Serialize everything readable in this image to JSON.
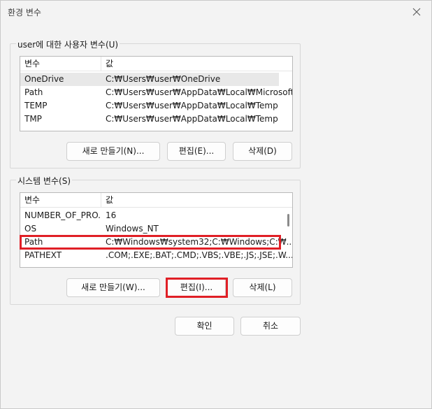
{
  "window": {
    "title": "환경 변수"
  },
  "user_vars": {
    "group_label": "user에 대한 사용자 변수(U)",
    "columns": [
      "변수",
      "값"
    ],
    "rows": [
      {
        "name": "OneDrive",
        "value": "C:₩Users₩user₩OneDrive"
      },
      {
        "name": "Path",
        "value": "C:₩Users₩user₩AppData₩Local₩Microsoft..."
      },
      {
        "name": "TEMP",
        "value": "C:₩Users₩user₩AppData₩Local₩Temp"
      },
      {
        "name": "TMP",
        "value": "C:₩Users₩user₩AppData₩Local₩Temp"
      }
    ],
    "buttons": {
      "new": "새로 만들기(N)...",
      "edit": "편집(E)...",
      "delete": "삭제(D)"
    }
  },
  "system_vars": {
    "group_label": "시스템 변수(S)",
    "columns": [
      "변수",
      "값"
    ],
    "rows": [
      {
        "name": "NUMBER_OF_PRO...",
        "value": "16"
      },
      {
        "name": "OS",
        "value": "Windows_NT"
      },
      {
        "name": "Path",
        "value": "C:₩Windows₩system32;C:₩Windows;C:₩..."
      },
      {
        "name": "PATHEXT",
        "value": ".COM;.EXE;.BAT;.CMD;.VBS;.VBE;.JS;.JSE;.W..."
      }
    ],
    "buttons": {
      "new": "새로 만들기(W)...",
      "edit": "편집(I)...",
      "delete": "삭제(L)"
    }
  },
  "footer": {
    "ok": "확인",
    "cancel": "취소"
  },
  "colors": {
    "highlight": "#e01f26",
    "background": "#f3f3f3"
  }
}
